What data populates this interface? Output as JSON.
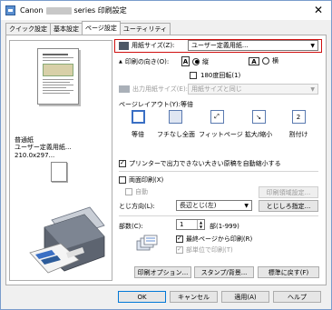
{
  "window": {
    "title_prefix": "Canon",
    "title_suffix": "series 印刷設定",
    "close_glyph": "✕"
  },
  "tabs": [
    {
      "label": "クイック設定"
    },
    {
      "label": "基本設定"
    },
    {
      "label": "ページ設定"
    },
    {
      "label": "ユーティリティ"
    }
  ],
  "preview": {
    "media": "普通紙",
    "size_info": "ユーザー定義用紙... 210.0x297..."
  },
  "page_setup": {
    "paper_size_label": "用紙サイズ(Z):",
    "paper_size_value": "ユーザー定義用紙...",
    "orientation_label": "印刷の向き(O):",
    "portrait_label": "縦",
    "landscape_label": "横",
    "rotate180_label": "180度回転(1)",
    "output_size_label": "出力用紙サイズ(E):",
    "output_size_value": "用紙サイズと同じ",
    "layout_label": "ページレイアウト(Y):等倍",
    "layouts": [
      {
        "label": "等倍",
        "glyph": ""
      },
      {
        "label": "フチなし全面",
        "glyph": ""
      },
      {
        "label": "フィットページ",
        "glyph": ""
      },
      {
        "label": "拡大/縮小",
        "glyph": ""
      },
      {
        "label": "割付け",
        "glyph": "2"
      }
    ],
    "auto_reduce_label": "プリンターで出力できない大きい原稿を自動縮小する",
    "duplex_label": "両面印刷(X)",
    "auto_label": "自動",
    "print_area_button": "印刷領域設定...",
    "binding_label": "とじ方向(L):",
    "binding_value": "長辺とじ(左)",
    "margin_button": "とじしろ指定...",
    "copies_label": "部数(C):",
    "copies_value": "1",
    "copies_range": "部(1-999)",
    "last_page_label": "最終ページから印刷(R)",
    "collate_label": "部単位で印刷(T)",
    "print_options_button": "印刷オプション...",
    "stamp_button": "スタンプ/背景...",
    "defaults_button": "標準に戻す(F)"
  },
  "footer": {
    "ok": "OK",
    "cancel": "キャンセル",
    "apply": "適用(A)",
    "help": "ヘルプ"
  },
  "colors": {
    "highlight": "#d01010",
    "accent": "#3a6fc4"
  }
}
